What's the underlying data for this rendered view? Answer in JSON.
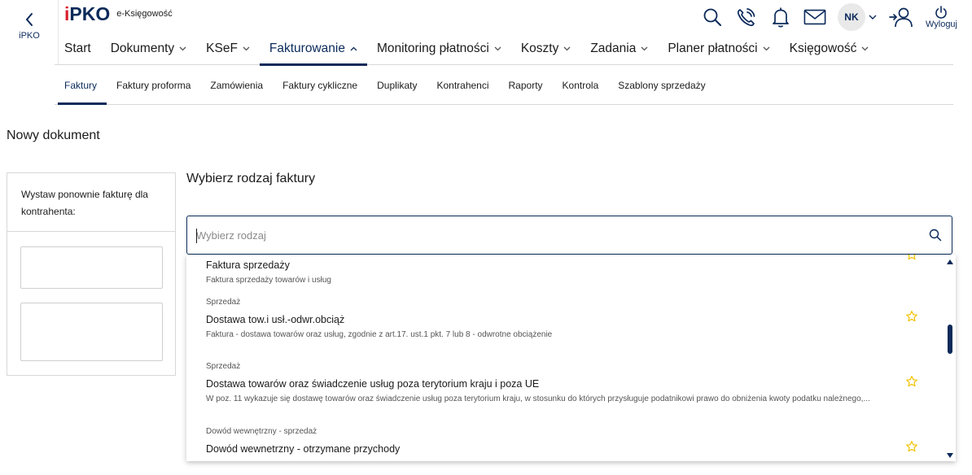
{
  "app": {
    "back_label": "iPKO",
    "logo_text": "PKO",
    "logo_i": "i",
    "product": "e-Księgowość"
  },
  "header": {
    "icons": [
      "search-icon",
      "phone-icon",
      "bell-icon",
      "mail-icon",
      "user-switch-icon",
      "power-icon"
    ],
    "avatar_initials": "NK",
    "logout_label": "Wyloguj"
  },
  "main_nav": [
    {
      "label": "Start",
      "dropdown": false,
      "active": false
    },
    {
      "label": "Dokumenty",
      "dropdown": true,
      "active": false
    },
    {
      "label": "KSeF",
      "dropdown": true,
      "active": false
    },
    {
      "label": "Fakturowanie",
      "dropdown": true,
      "active": true
    },
    {
      "label": "Monitoring płatności",
      "dropdown": true,
      "active": false
    },
    {
      "label": "Koszty",
      "dropdown": true,
      "active": false
    },
    {
      "label": "Zadania",
      "dropdown": true,
      "active": false
    },
    {
      "label": "Planer płatności",
      "dropdown": true,
      "active": false
    },
    {
      "label": "Księgowość",
      "dropdown": true,
      "active": false
    }
  ],
  "sub_nav": [
    {
      "label": "Faktury",
      "active": true
    },
    {
      "label": "Faktury proforma",
      "active": false
    },
    {
      "label": "Zamówienia",
      "active": false
    },
    {
      "label": "Faktury cykliczne",
      "active": false
    },
    {
      "label": "Duplikaty",
      "active": false
    },
    {
      "label": "Kontrahenci",
      "active": false
    },
    {
      "label": "Raporty",
      "active": false
    },
    {
      "label": "Kontrola",
      "active": false
    },
    {
      "label": "Szablony sprzedaży",
      "active": false
    }
  ],
  "page": {
    "title": "Nowy dokument",
    "left_panel_text": "Wystaw ponownie fakturę dla kontrahenta:",
    "section_title": "Wybierz rodzaj faktury",
    "search_placeholder": "Wybierz rodzaj"
  },
  "options": [
    {
      "category": "",
      "name": "Faktura sprzedaży",
      "description": "Faktura sprzedaży towarów i usług"
    },
    {
      "category": "Sprzedaż",
      "name": "Dostawa tow.i usł.-odwr.obciąż",
      "description": "Faktura - dostawa towarów oraz usług, zgodnie z art.17. ust.1 pkt. 7 lub 8 - odwrotne obciążenie"
    },
    {
      "category": "Sprzedaż",
      "name": "Dostawa towarów oraz świadczenie usług poza terytorium kraju i poza UE",
      "description": "W poz. 11 wykazuje się dostawę towarów oraz świadczenie usług poza terytorium kraju, w stosunku do których przysługuje podatnikowi prawo do obniżenia kwoty podatku należnego,..."
    },
    {
      "category": "Dowód wewnętrzny - sprzedaż",
      "name": "Dowód wewnetrzny - otrzymane przychody",
      "description": ""
    }
  ],
  "colors": {
    "brand_navy": "#0b2a5a",
    "brand_red": "#d81e2c",
    "star": "#f2c200"
  }
}
